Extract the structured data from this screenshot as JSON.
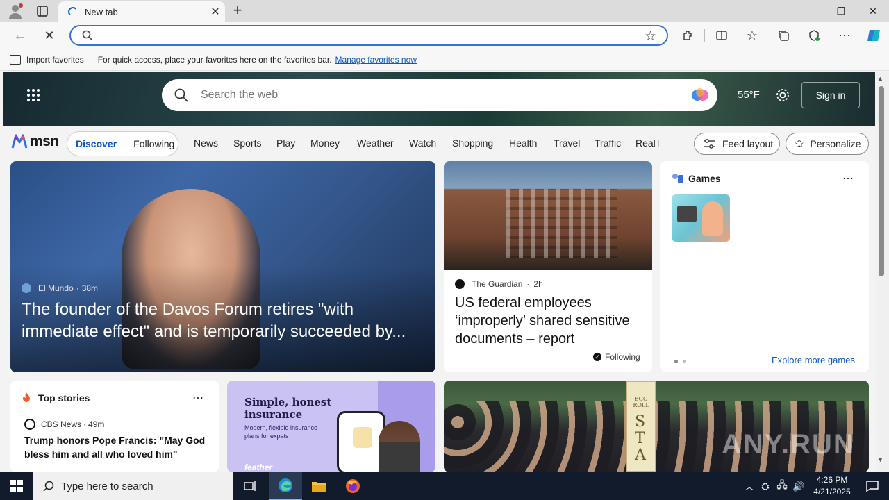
{
  "browser": {
    "tab_title": "New tab",
    "omnibox_value": "",
    "favorites_bar": {
      "import_label": "Import favorites",
      "message": "For quick access, place your favorites here on the favorites bar.",
      "manage_link": "Manage favorites now"
    }
  },
  "msn": {
    "logo_text": "msn",
    "search_placeholder": "Search the web",
    "temperature": "55°F",
    "sign_in": "Sign in",
    "tabs": [
      "Discover",
      "Following"
    ],
    "nav": [
      "News",
      "Sports",
      "Play",
      "Money",
      "Weather",
      "Watch",
      "Shopping",
      "Health",
      "Travel",
      "Traffic",
      "Real E"
    ],
    "feed_layout": "Feed layout",
    "personalize": "Personalize",
    "hero_story": {
      "source": "El Mundo",
      "age": "38m",
      "headline": "The founder of the Davos Forum retires \"with immediate effect\" and is temporarily succeeded by..."
    },
    "story2": {
      "source": "The Guardian",
      "age": "2h",
      "headline": "US federal employees ‘improperly’ shared sensitive documents – report",
      "following": "Following"
    },
    "games": {
      "title": "Games",
      "explore": "Explore more games"
    },
    "top_stories": {
      "title": "Top stories",
      "source": "CBS News",
      "age": "49m",
      "headline": "Trump honors Pope Francis: \"May God bless him and all who loved him\""
    },
    "ad": {
      "headline": "Simple, honest insurance",
      "sub": "Modern, flexible insurance plans for expats",
      "brand": "feather"
    },
    "photo_sign_top": "EGG ROLL",
    "photo_sign_bottom": "STA",
    "watermark": "ANY.RUN"
  },
  "taskbar": {
    "search_placeholder": "Type here to search",
    "time": "4:26 PM",
    "date": "4/21/2025"
  },
  "colors": {
    "accent_blue": "#0b57c5",
    "taskbar_bg": "#111b2b",
    "omnibox_border": "#3a6fd8"
  }
}
